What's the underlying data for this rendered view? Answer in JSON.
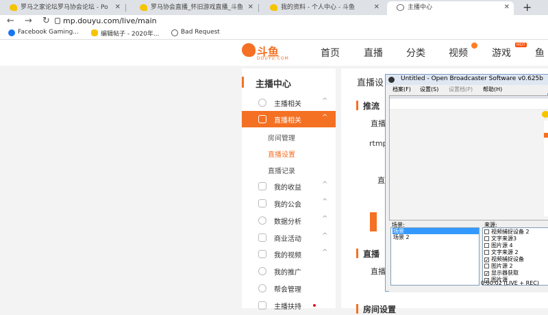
{
  "browser": {
    "tabs": [
      {
        "title": "罗马之家论坛罗马协会论坛 - Po",
        "active": false
      },
      {
        "title": "罗马协会直播_怀旧游戏直播_斗鱼",
        "active": false
      },
      {
        "title": "我的资料 - 个人中心 - 斗鱼",
        "active": false
      },
      {
        "title": "主播中心",
        "active": true
      }
    ],
    "url": "mp.douyu.com/live/main",
    "bookmarks": [
      "Facebook Gaming...",
      "编辑帖子 - 2020年...",
      "Bad Request"
    ]
  },
  "site": {
    "logo_text": "斗鱼",
    "logo_sub": "DOUYU.COM",
    "nav": [
      "首页",
      "直播",
      "分类",
      "视频",
      "游戏",
      "鱼"
    ],
    "hot_badge": "HOT"
  },
  "sidebar": {
    "title": "主播中心",
    "items": [
      {
        "label": "主播相关",
        "chevron": "^"
      },
      {
        "label": "直播相关",
        "chevron": "^"
      },
      {
        "label": "我的收益",
        "chevron": "^"
      },
      {
        "label": "我的公会",
        "chevron": "^"
      },
      {
        "label": "数据分析",
        "chevron": "^"
      },
      {
        "label": "商业活动",
        "chevron": "^"
      },
      {
        "label": "我的视频",
        "chevron": "^"
      },
      {
        "label": "我的推广",
        "chevron": ""
      },
      {
        "label": "帮会管理",
        "chevron": ""
      },
      {
        "label": "主播扶持",
        "chevron": ""
      }
    ],
    "subitems": [
      "房间管理",
      "直播设置",
      "直播记录"
    ]
  },
  "main": {
    "header": "直播设",
    "section1": "推流",
    "row1": "直播",
    "rtmp": "rtmp",
    "row3": "直",
    "section2": "直播",
    "row4": "直播",
    "section3": "房间设置"
  },
  "obs": {
    "title": "Untitled - Open Broadcaster Software v0.625b",
    "menu": [
      "档案(F)",
      "设置(S)",
      "设置档(P)",
      "帮助(H)"
    ],
    "scenes_label": "场景:",
    "scenes": [
      "场景",
      "场景 2"
    ],
    "sources_label": "来源:",
    "sources": [
      {
        "label": "视频捕捉设备 2",
        "checked": false
      },
      {
        "label": "文字来源3",
        "checked": false
      },
      {
        "label": "图片源 4",
        "checked": false
      },
      {
        "label": "文字来源 2",
        "checked": false
      },
      {
        "label": "视频捕捉设备",
        "checked": true
      },
      {
        "label": "图片源 2",
        "checked": false
      },
      {
        "label": "显示器获取",
        "checked": true
      },
      {
        "label": "图片源",
        "checked": true
      }
    ],
    "status": "0:00:02 (LIVE + REC)"
  }
}
